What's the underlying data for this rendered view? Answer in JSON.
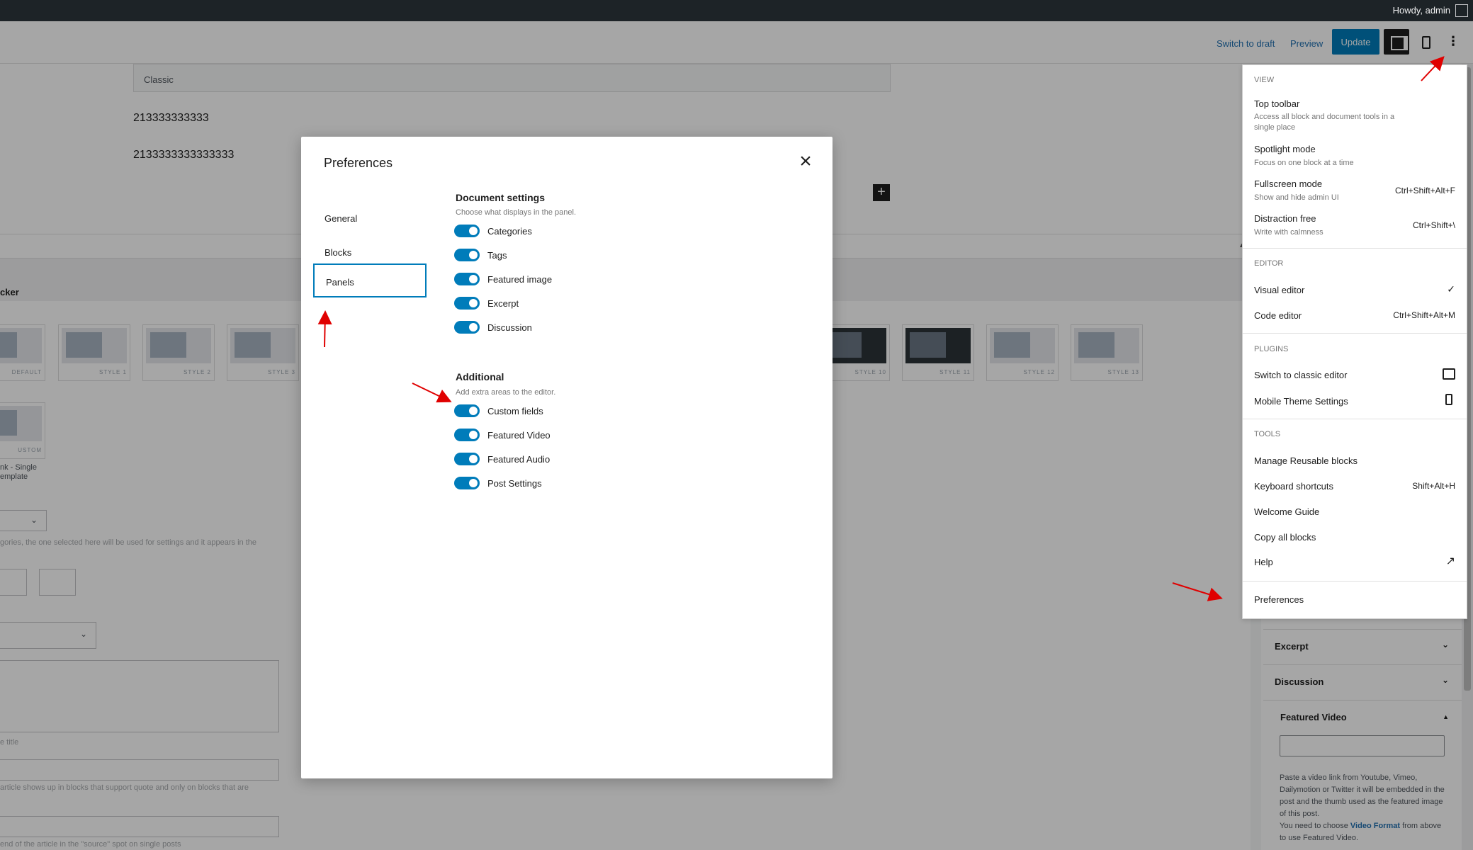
{
  "admin_bar": {
    "greeting": "Howdy, admin"
  },
  "header": {
    "switch_to_draft": "Switch to draft",
    "preview": "Preview",
    "update": "Update"
  },
  "canvas": {
    "classic_label": "Classic",
    "paragraph_1": "213333333333",
    "paragraph_2": "2133333333333333",
    "meta_heading": "cker",
    "thumbs": [
      "DEFAULT",
      "STYLE 1",
      "STYLE 2",
      "STYLE 3",
      "STYLE 10",
      "STYLE 11",
      "STYLE 12",
      "STYLE 13"
    ],
    "custom_thumb": "USTOM",
    "custom_caption_1": "nk - Single",
    "custom_caption_2": "emplate",
    "faint_1": "gories, the one selected here will be used for settings and it appears in the",
    "faint_2": "e title",
    "faint_3": "article shows up in blocks that support quote and only on blocks that are",
    "faint_4": "end of the article in the \"source\" spot on single posts"
  },
  "sidebar": {
    "excerpt": "Excerpt",
    "discussion": "Discussion",
    "featured_video": "Featured Video",
    "fv_help": "Paste a video link from Youtube, Vimeo, Dailymotion or Twitter it will be embedded in the post and the thumb used as the featured image of this post.",
    "fv_help_2_pre": "You need to choose",
    "fv_help_2_link": "Video Format",
    "fv_help_2_post": "from above to use Featured Video."
  },
  "menu": {
    "view": {
      "heading": "VIEW",
      "items": [
        {
          "label": "Top toolbar",
          "desc": "Access all block and document tools in a single place",
          "shortcut": ""
        },
        {
          "label": "Spotlight mode",
          "desc": "Focus on one block at a time",
          "shortcut": ""
        },
        {
          "label": "Fullscreen mode",
          "desc": "Show and hide admin UI",
          "shortcut": "Ctrl+Shift+Alt+F"
        },
        {
          "label": "Distraction free",
          "desc": "Write with calmness",
          "shortcut": "Ctrl+Shift+\\"
        }
      ]
    },
    "editor": {
      "heading": "EDITOR",
      "items": [
        {
          "label": "Visual editor",
          "shortcut": "✓"
        },
        {
          "label": "Code editor",
          "shortcut": "Ctrl+Shift+Alt+M"
        }
      ]
    },
    "plugins": {
      "heading": "PLUGINS",
      "items": [
        {
          "label": "Switch to classic editor"
        },
        {
          "label": "Mobile Theme Settings"
        }
      ]
    },
    "tools": {
      "heading": "TOOLS",
      "items": [
        {
          "label": "Manage Reusable blocks",
          "shortcut": ""
        },
        {
          "label": "Keyboard shortcuts",
          "shortcut": "Shift+Alt+H"
        },
        {
          "label": "Welcome Guide",
          "shortcut": ""
        },
        {
          "label": "Copy all blocks",
          "shortcut": ""
        },
        {
          "label": "Help",
          "shortcut": ""
        }
      ]
    },
    "preferences": "Preferences"
  },
  "modal": {
    "title": "Preferences",
    "tabs": [
      "General",
      "Blocks",
      "Panels"
    ],
    "active_tab": "Panels",
    "document_settings": {
      "title": "Document settings",
      "desc": "Choose what displays in the panel.",
      "options": [
        "Categories",
        "Tags",
        "Featured image",
        "Excerpt",
        "Discussion"
      ]
    },
    "additional": {
      "title": "Additional",
      "desc": "Add extra areas to the editor.",
      "options": [
        "Custom fields",
        "Featured Video",
        "Featured Audio",
        "Post Settings"
      ]
    }
  },
  "colors": {
    "accent": "#007cba",
    "admin_bar": "#1d2327",
    "arrow": "#e00000"
  }
}
